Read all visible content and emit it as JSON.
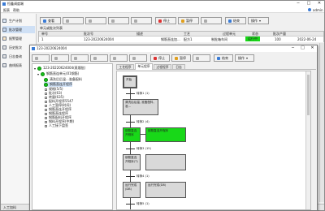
{
  "main": {
    "title": "恒鑫调度端",
    "menu": [
      "报表",
      "帮助"
    ],
    "user": "admin",
    "sidebar": [
      "生产计划",
      "批次管理",
      "报警管理",
      "历史批次",
      "日志查询",
      "曲线报表"
    ],
    "toolbar": [
      "查看",
      "",
      "",
      "",
      "",
      "停止",
      "暂停",
      "",
      "结束",
      "操作"
    ],
    "grid_title": "单元或批次列表",
    "columns": [
      "单号",
      "批次号",
      "描述",
      "工艺",
      "过程单元",
      "状态",
      "批次产量",
      ""
    ],
    "row": [
      "1",
      "123-20220624004",
      "",
      "钢筋直连加...",
      "配方1",
      "制批箱车间",
      "运行中",
      "100",
      "2022-06-24"
    ],
    "statusbar": "入工加料"
  },
  "dialog": {
    "title": "123-20220624004",
    "toolbar": [
      "",
      "",
      "",
      "",
      "",
      "",
      "停止",
      "暂停",
      "",
      "结束",
      "操作"
    ],
    "tree_root": "123-20220624004(蒸馏批)",
    "tree_parent": "钢筋直连单元(01钢筋)",
    "tree_items": [
      "清洗后后温...准备配料",
      "钢筋直连开程序",
      "规格(5/5)",
      "批次(63)",
      "转量(635)",
      "配料开程序5547",
      "人工暂停(时间)",
      "钢筋直连开程序",
      "钢筋直连程序",
      "钢筋配料开程序",
      "钢料开程序(中期)",
      "人工接下盘签"
    ],
    "tabs": [
      "工艺程序",
      "单元程序",
      "过程程序",
      "日志"
    ],
    "sfc": {
      "start": "开始",
      "steps": [
        "清洗后后温, 准备配料, 准...",
        "钢筋直连开程序",
        "钢筋直连开程序",
        "钢筋直连开程序(T)",
        "运行完成(DB)",
        "运行完成(D8)"
      ],
      "transitions": [
        "转换1 (1)",
        "转换2 (4)",
        "转换3 (15)",
        "转换4 (1)",
        "转换5 (1)"
      ]
    }
  },
  "colors": {
    "running": "#18d818",
    "accent": "#2060b0"
  }
}
